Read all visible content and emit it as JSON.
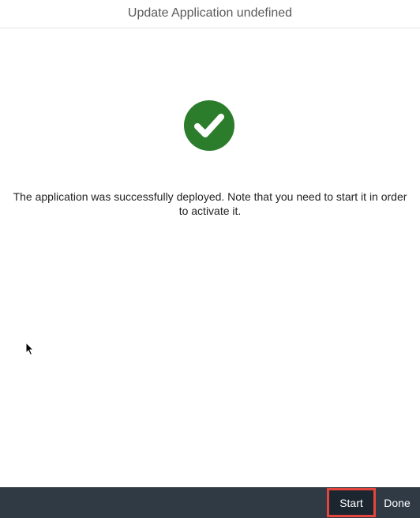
{
  "dialog": {
    "title": "Update Application undefined",
    "icon": "checkmark-circle-icon",
    "success_color": "#2b7d2b",
    "message": "The application was successfully deployed. Note that you need to start it in order to activate it."
  },
  "footer": {
    "start_label": "Start",
    "done_label": "Done",
    "highlight_color": "#e5453c",
    "background": "#2f3a45"
  }
}
